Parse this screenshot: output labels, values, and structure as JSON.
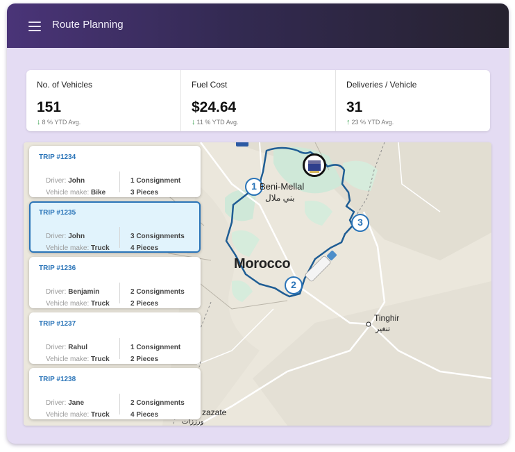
{
  "header": {
    "title": "Route Planning"
  },
  "stats": [
    {
      "label": "No. of Vehicles",
      "value": "151",
      "delta": "8 % YTD Avg.",
      "trend": "down"
    },
    {
      "label": "Fuel Cost",
      "value": "$24.64",
      "delta": "11 % YTD Avg.",
      "trend": "down"
    },
    {
      "label": "Deliveries / Vehicle",
      "value": "31",
      "delta": "23 % YTD Avg.",
      "trend": "up"
    }
  ],
  "trip_labels": {
    "driver": "Driver:",
    "vehicle_make": "Vehicle make:"
  },
  "trips": [
    {
      "id": "TRIP #1234",
      "driver": "John",
      "vehicle": "Bike",
      "consignments": "1 Consignment",
      "pieces": "3 Pieces"
    },
    {
      "id": "TRIP #1235",
      "driver": "John",
      "vehicle": "Truck",
      "consignments": "3 Consignments",
      "pieces": "4 Pieces",
      "selected": true
    },
    {
      "id": "TRIP #1236",
      "driver": "Benjamin",
      "vehicle": "Truck",
      "consignments": "2 Consignments",
      "pieces": "2 Pieces"
    },
    {
      "id": "TRIP #1237",
      "driver": "Rahul",
      "vehicle": "Truck",
      "consignments": "1 Consignment",
      "pieces": "2 Pieces"
    },
    {
      "id": "TRIP #1238",
      "driver": "Jane",
      "vehicle": "Truck",
      "consignments": "2 Consignments",
      "pieces": "4 Pieces"
    }
  ],
  "map": {
    "country": "Morocco",
    "cities": {
      "beni_mellal": "Beni-Mellal",
      "beni_mellal_ar": "بني ملال",
      "tinghir": "Tinghir",
      "tinghir_ar": "تنغير",
      "ouarzazate_partial": "zazate",
      "ouarzazate_ar_partial": "ورززات"
    },
    "stops": [
      "1",
      "2",
      "3"
    ],
    "route_color": "#1f5d94",
    "accent_color": "#2a74b8"
  }
}
